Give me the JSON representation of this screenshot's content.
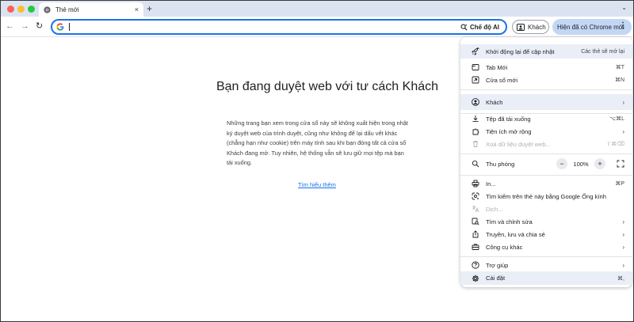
{
  "tab": {
    "title": "Thẻ mới",
    "close": "×"
  },
  "tabstrip": {
    "new_tab": "+",
    "tab_search": "⌄"
  },
  "toolbar": {
    "back": "←",
    "forward": "→",
    "reload": "↻",
    "ai_mode_label": "Chế độ AI",
    "guest_label": "Khách",
    "update_label": "Hiện đã có Chrome mới",
    "menu_dots": "⋮"
  },
  "page": {
    "heading": "Bạn đang duyệt web với tư cách Khách",
    "description": "Những trang bạn xem trong cửa sổ này sẽ không xuất hiện trong nhật ký duyệt web của trình duyệt, cũng như không để lại dấu vết khác (chẳng hạn như cookie) trên máy tính sau khi bạn đóng tất cả cửa sổ Khách đang mở. Tuy nhiên, hệ thống vẫn sẽ lưu giữ mọi tệp mà bạn tải xuống.",
    "learn_more": "Tìm hiểu thêm"
  },
  "menu": {
    "restart": {
      "label": "Khởi động lại để cập nhật",
      "note": "Các thẻ sẽ mở lại"
    },
    "new_tab": {
      "label": "Tab Mới",
      "shortcut": "⌘T"
    },
    "new_window": {
      "label": "Cửa sổ mới",
      "shortcut": "⌘N"
    },
    "profile": {
      "label": "Khách"
    },
    "downloads": {
      "label": "Tệp đã tải xuống",
      "shortcut": "⌥⌘L"
    },
    "extensions": {
      "label": "Tiện ích mở rộng"
    },
    "clear_data": {
      "label": "Xoá dữ liệu duyệt web...",
      "shortcut": "⇧⌘⌫"
    },
    "zoom": {
      "label": "Thu phóng",
      "minus": "−",
      "value": "100%",
      "plus": "+"
    },
    "print": {
      "label": "In...",
      "shortcut": "⌘P"
    },
    "lens": {
      "label": "Tìm kiếm trên thẻ này bằng Google Ống kính"
    },
    "translate": {
      "label": "Dịch..."
    },
    "find_edit": {
      "label": "Tìm và chỉnh sửa"
    },
    "cast_save_share": {
      "label": "Truyền, lưu và chia sẻ"
    },
    "more_tools": {
      "label": "Công cụ khác"
    },
    "help": {
      "label": "Trợ giúp"
    },
    "settings": {
      "label": "Cài đặt",
      "shortcut": "⌘,"
    },
    "submenu_arrow": "›"
  },
  "colors": {
    "accent": "#1a73e8",
    "update_chip": "#c2d7f5",
    "tabstrip": "#dbe3f1",
    "highlight": "#e9eef7"
  }
}
